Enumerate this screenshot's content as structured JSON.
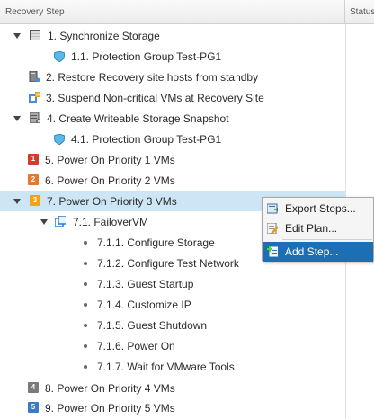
{
  "columns": {
    "recovery_step": "Recovery Step",
    "status": "Status"
  },
  "steps": [
    {
      "label": "1. Synchronize Storage",
      "icon": "storage-icon",
      "expanded": true
    },
    {
      "label": "1.1. Protection Group Test-PG1",
      "icon": "shield-icon"
    },
    {
      "label": "2. Restore Recovery site hosts from standby",
      "icon": "host-icon"
    },
    {
      "label": "3. Suspend Non-critical VMs at Recovery Site",
      "icon": "suspend-vms-icon"
    },
    {
      "label": "4. Create Writeable Storage Snapshot",
      "icon": "snapshot-icon",
      "expanded": true
    },
    {
      "label": "4.1. Protection Group Test-PG1",
      "icon": "shield-icon"
    },
    {
      "label": "5. Power On Priority 1 VMs",
      "icon": "priority-1-icon",
      "badge": "1",
      "badge_color": "#d93a2b"
    },
    {
      "label": "6. Power On Priority 2 VMs",
      "icon": "priority-2-icon",
      "badge": "2",
      "badge_color": "#e6782a"
    },
    {
      "label": "7. Power On Priority 3 VMs",
      "icon": "priority-3-icon",
      "badge": "3",
      "badge_color": "#f0a21f",
      "expanded": true,
      "selected": true
    },
    {
      "label": "7.1. FailoverVM",
      "icon": "vm-icon",
      "expanded": true
    },
    {
      "label": "7.1.1. Configure Storage"
    },
    {
      "label": "7.1.2. Configure Test Network"
    },
    {
      "label": "7.1.3. Guest Startup"
    },
    {
      "label": "7.1.4. Customize IP"
    },
    {
      "label": "7.1.5. Guest Shutdown"
    },
    {
      "label": "7.1.6. Power On"
    },
    {
      "label": "7.1.7. Wait for VMware Tools"
    },
    {
      "label": "8. Power On Priority 4 VMs",
      "icon": "priority-4-icon",
      "badge": "4",
      "badge_color": "#7a7a7a"
    },
    {
      "label": "9. Power On Priority 5 VMs",
      "icon": "priority-5-icon",
      "badge": "5",
      "badge_color": "#3a7cc4"
    }
  ],
  "context_menu": {
    "items": [
      {
        "label": "Export Steps...",
        "icon": "export-icon"
      },
      {
        "label": "Edit Plan...",
        "icon": "edit-icon"
      },
      {
        "label": "Add Step...",
        "icon": "add-step-icon",
        "highlighted": true
      }
    ]
  },
  "colors": {
    "selection": "#cde6f5",
    "menu_highlight": "#1d6fb5"
  }
}
